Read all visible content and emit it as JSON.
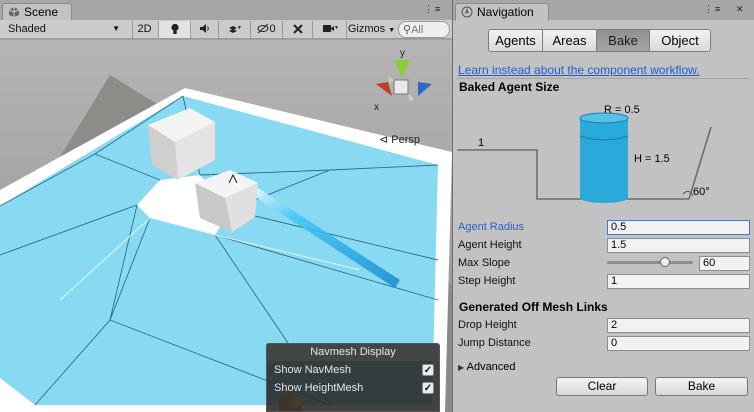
{
  "scene": {
    "tab_title": "Scene",
    "toolbar": {
      "shading": "Shaded",
      "mode_2d": "2D",
      "effects_count": "0",
      "gizmos": "Gizmos",
      "search_placeholder": "All"
    },
    "gizmo": {
      "y": "y",
      "x": "x",
      "projection": "Persp"
    },
    "navmesh_display": {
      "title": "Navmesh Display",
      "show_navmesh": "Show NavMesh",
      "show_navmesh_checked": true,
      "show_heightmesh": "Show HeightMesh",
      "show_heightmesh_checked": true
    }
  },
  "navigation": {
    "tab_title": "Navigation",
    "tabs": [
      {
        "label": "Agents",
        "selected": false
      },
      {
        "label": "Areas",
        "selected": false
      },
      {
        "label": "Bake",
        "selected": true
      },
      {
        "label": "Object",
        "selected": false
      }
    ],
    "workflow_link": "Learn instead about the component workflow.",
    "baked_agent_size": {
      "header": "Baked Agent Size",
      "diagram": {
        "radius": "R = 0.5",
        "height": "H = 1.5",
        "step": "1",
        "slope": "60°"
      },
      "agent_radius_label": "Agent Radius",
      "agent_radius": "0.5",
      "agent_height_label": "Agent Height",
      "agent_height": "1.5",
      "max_slope_label": "Max Slope",
      "max_slope": "60",
      "max_slope_fraction": 0.67,
      "step_height_label": "Step Height",
      "step_height": "1"
    },
    "off_mesh_links": {
      "header": "Generated Off Mesh Links",
      "drop_height_label": "Drop Height",
      "drop_height": "2",
      "jump_distance_label": "Jump Distance",
      "jump_distance": "0"
    },
    "advanced_label": "Advanced",
    "clear_button": "Clear",
    "bake_button": "Bake"
  },
  "colors": {
    "accent": "#3a7be0",
    "navmesh": "#84d8ee",
    "link": "#1e5fce",
    "cylinder": "#2aa9db"
  }
}
